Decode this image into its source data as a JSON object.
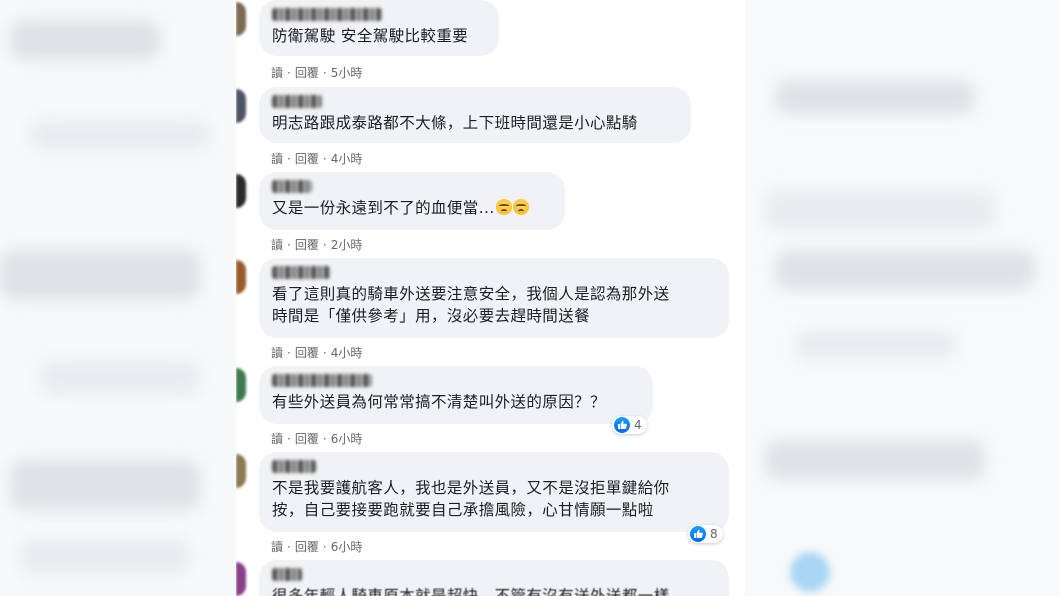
{
  "actions": {
    "read": "讀",
    "reply": "回覆",
    "separator": "·"
  },
  "comments": [
    {
      "text": "防衛駕駛 安全駕駛比較重要",
      "time": "5小時"
    },
    {
      "text": "明志路跟成泰路都不大條，上下班時間還是小心點騎",
      "time": "4小時"
    },
    {
      "text": "又是一份永遠到不了的血便當...",
      "emoji": [
        "crying-face",
        "crying-face"
      ],
      "time": "2小時"
    },
    {
      "text": "看了這則真的騎車外送要注意安全，我個人是認為那外送\n時間是「僅供參考」用，沒必要去趕時間送餐",
      "time": "4小時"
    },
    {
      "text": "有些外送員為何常常搞不清楚叫外送的原因？？",
      "time": "6小時",
      "reactions": "4"
    },
    {
      "text": "不是我要護航客人，我也是外送員，又不是沒拒單鍵給你\n按，自己要接要跑就要自己承擔風險，心甘情願一點啦",
      "time": "6小時",
      "reactions": "8"
    },
    {
      "text": "很多年輕人騎車原本就是超快　不管有沒有送外送都一樣"
    }
  ],
  "colors": {
    "bubble": "#f0f2f5",
    "like": "#0866ff",
    "meta": "#65676b",
    "text": "#1c1e21"
  }
}
